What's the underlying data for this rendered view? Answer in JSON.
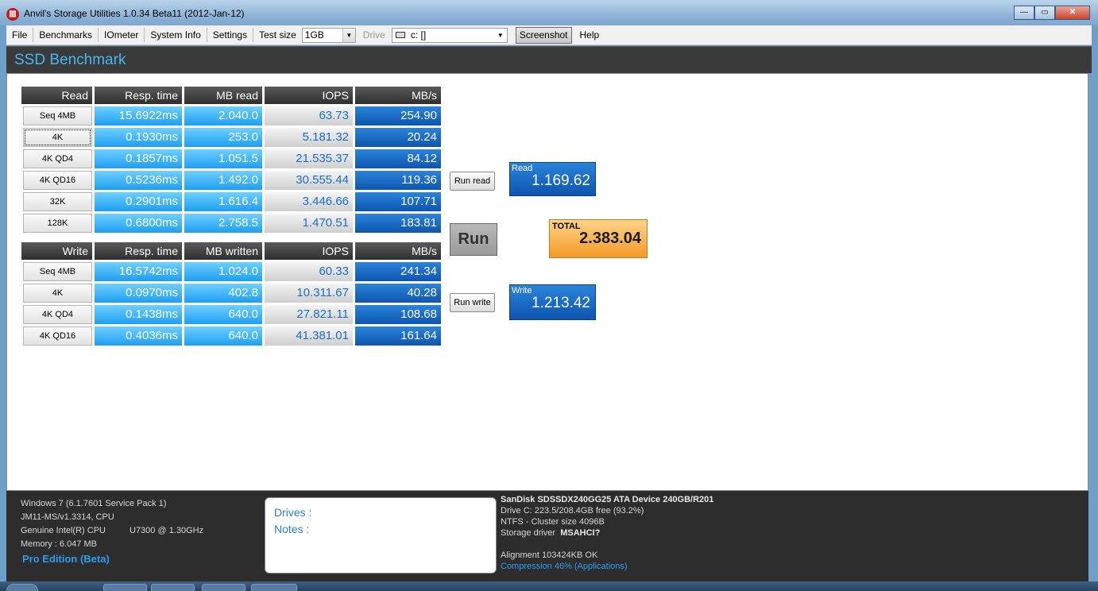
{
  "window": {
    "title": "Anvil's Storage Utilities 1.0.34 Beta11 (2012-Jan-12)"
  },
  "menu": {
    "file": "File",
    "benchmarks": "Benchmarks",
    "iometer": "IOmeter",
    "system_info": "System Info",
    "settings": "Settings",
    "test_size_label": "Test size",
    "test_size_value": "1GB",
    "drive_label": "Drive",
    "drive_value": "c: []",
    "screenshot": "Screenshot",
    "help": "Help"
  },
  "header": {
    "title": "SSD Benchmark"
  },
  "read": {
    "headers": [
      "Read",
      "Resp. time",
      "MB read",
      "IOPS",
      "MB/s"
    ],
    "rows": [
      {
        "label": "Seq 4MB",
        "resp": "15.6922ms",
        "mb": "2.040.0",
        "iops": "63.73",
        "mbs": "254.90"
      },
      {
        "label": "4K",
        "resp": "0.1930ms",
        "mb": "253.0",
        "iops": "5.181.32",
        "mbs": "20.24"
      },
      {
        "label": "4K QD4",
        "resp": "0.1857ms",
        "mb": "1.051.5",
        "iops": "21.535.37",
        "mbs": "84.12"
      },
      {
        "label": "4K QD16",
        "resp": "0.5236ms",
        "mb": "1.492.0",
        "iops": "30.555.44",
        "mbs": "119.36"
      },
      {
        "label": "32K",
        "resp": "0.2901ms",
        "mb": "1.616.4",
        "iops": "3.446.66",
        "mbs": "107.71"
      },
      {
        "label": "128K",
        "resp": "0.6800ms",
        "mb": "2.758.5",
        "iops": "1.470.51",
        "mbs": "183.81"
      }
    ]
  },
  "write": {
    "headers": [
      "Write",
      "Resp. time",
      "MB written",
      "IOPS",
      "MB/s"
    ],
    "rows": [
      {
        "label": "Seq 4MB",
        "resp": "16.5742ms",
        "mb": "1.024.0",
        "iops": "60.33",
        "mbs": "241.34"
      },
      {
        "label": "4K",
        "resp": "0.0970ms",
        "mb": "402.8",
        "iops": "10.311.67",
        "mbs": "40.28"
      },
      {
        "label": "4K QD4",
        "resp": "0.1438ms",
        "mb": "640.0",
        "iops": "27.821.11",
        "mbs": "108.68"
      },
      {
        "label": "4K QD16",
        "resp": "0.4036ms",
        "mb": "640.0",
        "iops": "41.381.01",
        "mbs": "161.64"
      }
    ]
  },
  "buttons": {
    "run_read": "Run read",
    "run": "Run",
    "run_write": "Run write"
  },
  "scores": {
    "read_label": "Read",
    "read_value": "1.169.62",
    "total_label": "TOTAL",
    "total_value": "2.383.04",
    "write_label": "Write",
    "write_value": "1.213.42"
  },
  "system": {
    "os": "Windows 7 (6.1.7601 Service Pack 1)",
    "board": "JM11-MS/v1.3314, CPU",
    "cpu_vendor": "Genuine Intel(R) CPU",
    "cpu_model": "U7300  @ 1.30GHz",
    "memory": "Memory : 6.047 MB",
    "edition": "Pro Edition (Beta)"
  },
  "notes": {
    "drives": "Drives :",
    "notes": "Notes :"
  },
  "device": {
    "name": "SanDisk SDSSDX240GG25 ATA Device 240GB/R201",
    "drive": "Drive C: 223.5/208.4GB free (93.2%)",
    "fs": "NTFS - Cluster size 4096B",
    "driver_label": "Storage driver",
    "driver_value": "MSAHCI?",
    "alignment": "Alignment 103424KB OK",
    "compression": "Compression 46% (Applications)"
  }
}
